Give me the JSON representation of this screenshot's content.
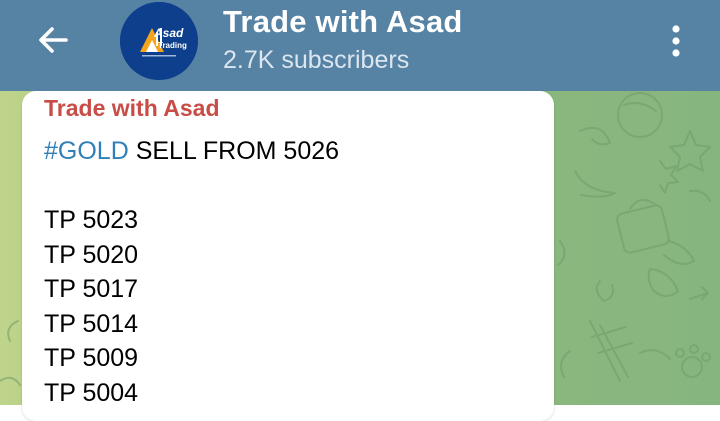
{
  "header": {
    "back_icon": "arrow-left-icon",
    "title": "Trade with Asad",
    "subscribers": "2.7K subscribers",
    "menu_icon": "more-vertical-icon",
    "background_color": "#5682a3"
  },
  "avatar": {
    "logo_text_line1": "Asad",
    "logo_text_line2": "Trading",
    "background_color": "#0d3f8c"
  },
  "message": {
    "sender": "Trade with Asad",
    "hashtag": "#GOLD",
    "first_line_rest": " SELL FROM 5026",
    "lines": [
      "",
      "TP 5023",
      "TP 5020",
      "TP 5017",
      "TP 5014",
      "TP 5009",
      "TP 5004"
    ]
  },
  "colors": {
    "sender_name": "#c84d46",
    "hashtag_link": "#2f7fb9",
    "chat_wallpaper": "#8fb97c"
  }
}
